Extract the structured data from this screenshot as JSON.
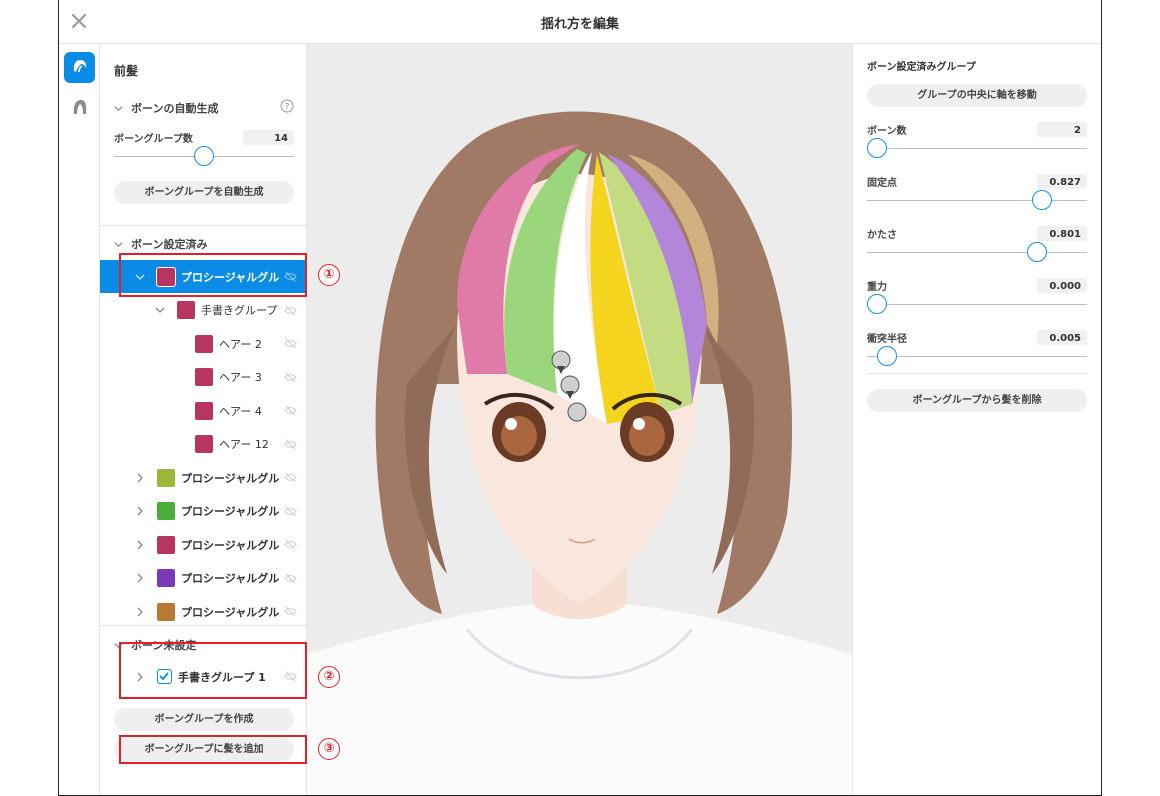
{
  "header": {
    "title": "揺れ方を編集"
  },
  "rail": {
    "icons": [
      "bangs-icon",
      "back-hair-icon"
    ]
  },
  "left_panel": {
    "title": "前髪",
    "auto_generate": {
      "heading": "ボーンの自動生成",
      "group_count_label": "ボーングループ数",
      "group_count_value": "14",
      "group_count_fraction": 0.5,
      "button": "ボーングループを自動生成"
    },
    "configured": {
      "heading": "ボーン設定済み",
      "rows": [
        {
          "label": "プロシージャルグル",
          "color": "#b83562",
          "selected": true
        },
        {
          "label": "手書きグループ",
          "color": "#b83562"
        },
        {
          "label": "ヘアー 2",
          "color": "#b83562"
        },
        {
          "label": "ヘアー 3",
          "color": "#b83562"
        },
        {
          "label": "ヘアー 4",
          "color": "#b83562"
        },
        {
          "label": "ヘアー 12",
          "color": "#b83562"
        },
        {
          "label": "プロシージャルグル",
          "color": "#9ab83a"
        },
        {
          "label": "プロシージャルグル",
          "color": "#4aae3d"
        },
        {
          "label": "プロシージャルグル",
          "color": "#b83562"
        },
        {
          "label": "プロシージャルグル",
          "color": "#7a3ab8"
        },
        {
          "label": "プロシージャルグル",
          "color": "#b87a35"
        }
      ]
    },
    "unconfigured": {
      "heading": "ボーン未設定",
      "row_label": "手書きグループ 1",
      "create_button": "ボーングループを作成",
      "add_button": "ボーングループに髪を追加"
    }
  },
  "right_panel": {
    "title": "ボーン設定済みグループ",
    "center_button": "グループの中央に軸を移動",
    "params": [
      {
        "label": "ボーン数",
        "value": "2",
        "fraction": 0.0
      },
      {
        "label": "固定点",
        "value": "0.827",
        "fraction": 0.827
      },
      {
        "label": "かたさ",
        "value": "0.801",
        "fraction": 0.801
      },
      {
        "label": "重力",
        "value": "0.000",
        "fraction": 0.0
      },
      {
        "label": "衝突半径",
        "value": "0.005",
        "fraction": 0.05
      }
    ],
    "remove_button": "ボーングループから髪を削除"
  },
  "annotations": [
    "①",
    "②",
    "③"
  ],
  "colors": {
    "accent": "#0a8ce6",
    "annotation": "#e0202a"
  }
}
